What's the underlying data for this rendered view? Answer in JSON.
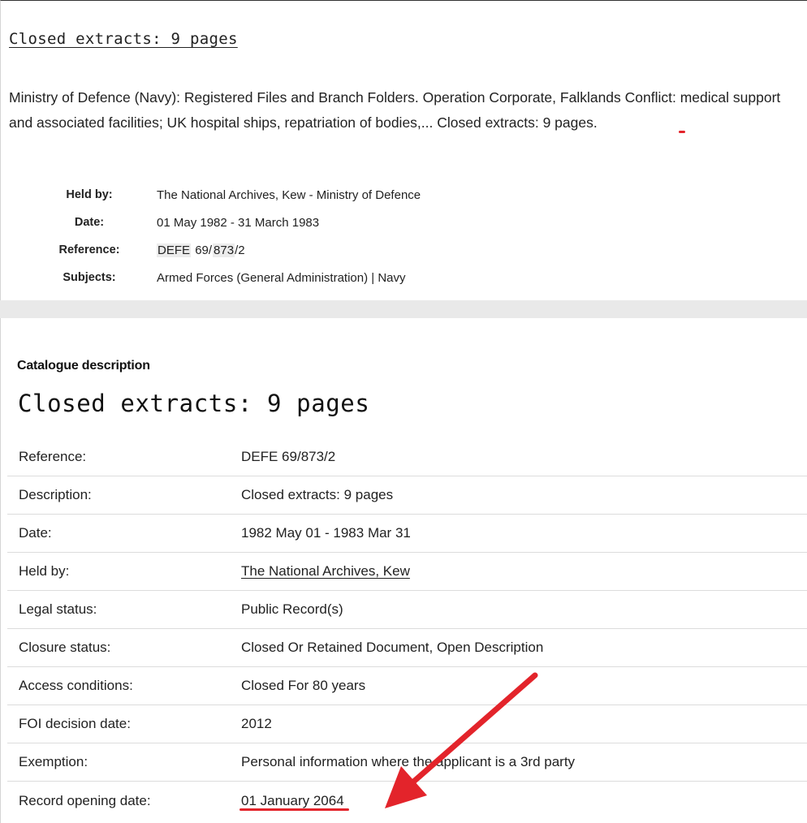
{
  "summary_card": {
    "title": "Closed extracts: 9 pages",
    "description_part1": "Ministry of Defence (Navy): Registered Files and Branch Folders. Operation Corporate, Falklands Conflict: ",
    "description_highlight": "medical support and associated facilities; UK hospital ships",
    "description_part2": ", repatriation of bodies,... Closed extracts: 9 pages.",
    "held_by_label": "Held by:",
    "held_by_value": "The National Archives, Kew - Ministry of Defence",
    "date_label": "Date:",
    "date_value": "01 May 1982 - 31 March 1983",
    "reference_label": "Reference:",
    "reference_parts": [
      "DEFE",
      "69/",
      "873",
      "/2"
    ],
    "subjects_label": "Subjects:",
    "subjects_value": "Armed Forces (General Administration) | Navy"
  },
  "catalogue": {
    "heading": "Catalogue description",
    "title": "Closed extracts: 9 pages",
    "rows": [
      {
        "label": "Reference:",
        "value": "DEFE 69/873/2"
      },
      {
        "label": "Description:",
        "value": "Closed extracts: 9 pages"
      },
      {
        "label": "Date:",
        "value": "1982 May 01 - 1983 Mar 31"
      },
      {
        "label": "Held by:",
        "value": "The National Archives, Kew"
      },
      {
        "label": "Legal status:",
        "value": "Public Record(s)"
      },
      {
        "label": "Closure status:",
        "value": "Closed Or Retained Document, Open Description"
      },
      {
        "label": "Access conditions:",
        "value": "Closed For 80 years"
      },
      {
        "label": "FOI decision date:",
        "value": "2012"
      },
      {
        "label": "Exemption:",
        "value": "Personal information where the applicant is a 3rd party"
      },
      {
        "label": "Record opening date:",
        "value": "01 January 2064"
      }
    ]
  },
  "annotation": {
    "color": "#e3242b"
  }
}
